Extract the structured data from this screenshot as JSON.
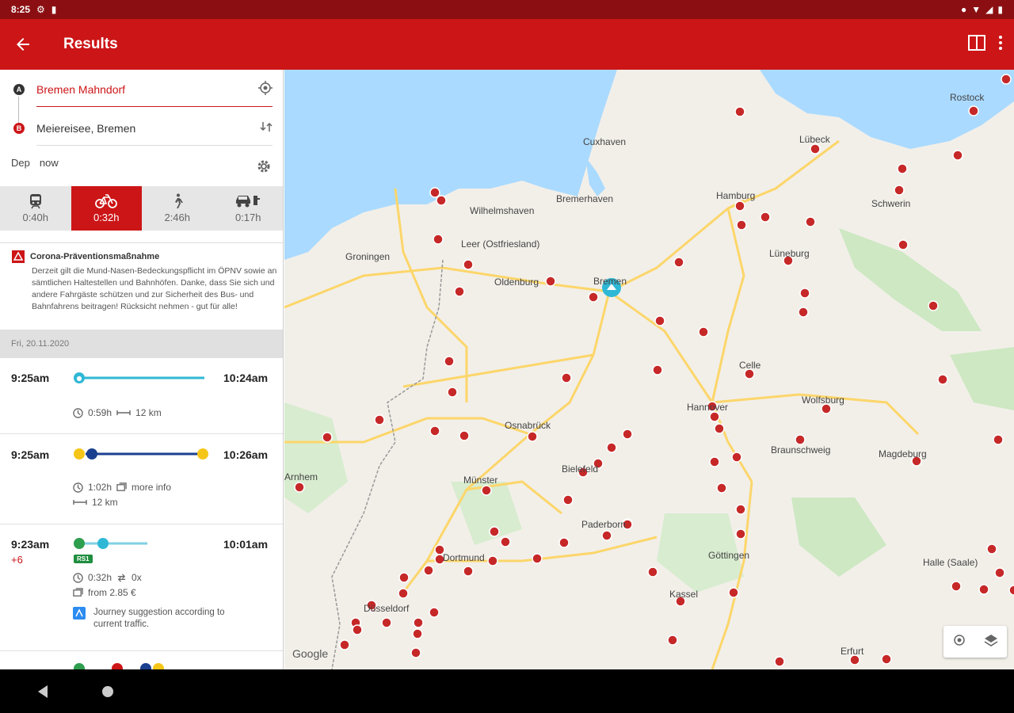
{
  "status": {
    "time": "8:25"
  },
  "appbar": {
    "title": "Results"
  },
  "search": {
    "from": "Bremen Mahndorf",
    "to": "Meiereisee, Bremen",
    "dep_label": "Dep",
    "dep_value": "now"
  },
  "modes": [
    {
      "label": "0:40h",
      "icon": "train-icon"
    },
    {
      "label": "0:32h",
      "icon": "bike-icon"
    },
    {
      "label": "2:46h",
      "icon": "walk-icon"
    },
    {
      "label": "0:17h",
      "icon": "car-icon"
    }
  ],
  "notice": {
    "title": "Corona-Präventionsmaßnahme",
    "body": "Derzeit gilt die Mund-Nasen-Bedeckungspflicht im ÖPNV sowie an sämtlichen Haltestellen und Bahnhöfen. Danke, dass Sie sich und andere Fahrgäste schützen und zur Sicherheit des Bus- und Bahnfahrens beitragen! Rücksicht nehmen - gut für alle!"
  },
  "date": "Fri, 20.11.2020",
  "journeys": [
    {
      "dep": "9:25am",
      "arr": "10:24am",
      "duration": "0:59h",
      "distance": "12 km"
    },
    {
      "dep": "9:25am",
      "arr": "10:26am",
      "duration": "1:02h",
      "more": "more info",
      "distance": "12 km"
    },
    {
      "dep": "9:23am",
      "delay": "+6",
      "arr": "10:01am",
      "line": "RS1",
      "duration": "0:32h",
      "changes": "0x",
      "price": "from 2.85 €",
      "hint": "Journey suggestion according to current traffic."
    }
  ],
  "map": {
    "cities": [
      "Cuxhaven",
      "Bremerhaven",
      "Wilhelmshaven",
      "Groningen",
      "Leer (Ostfriesland)",
      "Oldenburg",
      "Bremen",
      "Hamburg",
      "Lübeck",
      "Rostock",
      "Schwerin",
      "Lüneburg",
      "Celle",
      "Hannover",
      "Wolfsburg",
      "Braunschweig",
      "Magdeburg",
      "Osnabrück",
      "Münster",
      "Bielefeld",
      "Paderborn",
      "Dortmund",
      "Düsseldorf",
      "Kassel",
      "Göttingen",
      "Halle (Saale)",
      "Erfurt",
      "Arnhem",
      "Rostock"
    ],
    "google": "Google",
    "colors": {
      "water": "#aadaff",
      "land": "#f2efe9",
      "green": "#cde8c2",
      "road": "#fcd66a",
      "marker": "#c62828"
    }
  }
}
